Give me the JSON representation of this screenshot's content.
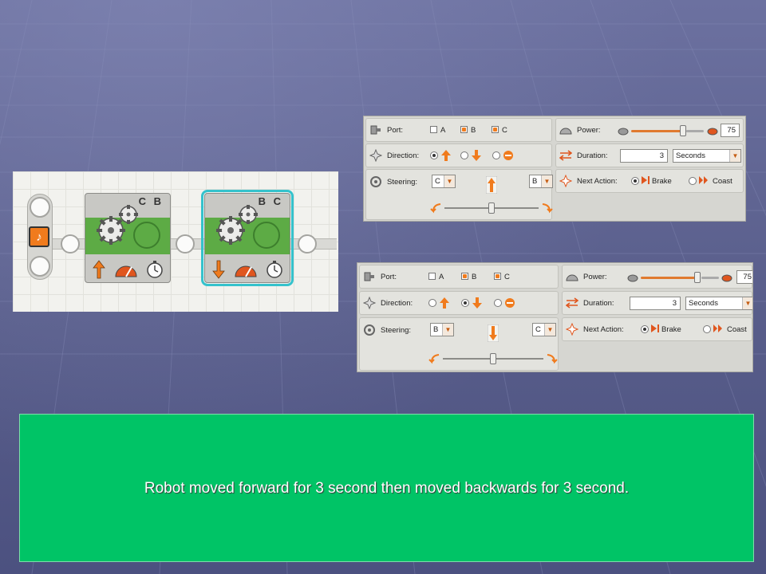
{
  "program": {
    "blocks": [
      {
        "ports": "C B",
        "direction": "forward"
      },
      {
        "ports": "B C",
        "direction": "backward",
        "selected": true
      }
    ]
  },
  "panel_a": {
    "port_label": "Port:",
    "port_options": [
      {
        "label": "A",
        "checked": false
      },
      {
        "label": "B",
        "checked": true
      },
      {
        "label": "C",
        "checked": true
      }
    ],
    "direction_label": "Direction:",
    "direction_selected": "forward",
    "steering_label": "Steering:",
    "steering_left": "C",
    "steering_right": "B",
    "steering_level": 0.5,
    "power_label": "Power:",
    "power_value": "75",
    "power_level": 0.75,
    "duration_label": "Duration:",
    "duration_value": "3",
    "duration_unit": "Seconds",
    "next_action_label": "Next Action:",
    "next_action_brake": "Brake",
    "next_action_coast": "Coast",
    "next_action_selected": "brake"
  },
  "panel_b": {
    "port_label": "Port:",
    "port_options": [
      {
        "label": "A",
        "checked": false
      },
      {
        "label": "B",
        "checked": true
      },
      {
        "label": "C",
        "checked": true
      }
    ],
    "direction_label": "Direction:",
    "direction_selected": "backward",
    "steering_label": "Steering:",
    "steering_left": "B",
    "steering_right": "C",
    "steering_level": 0.5,
    "power_label": "Power:",
    "power_value": "75",
    "power_level": 0.75,
    "duration_label": "Duration:",
    "duration_value": "3",
    "duration_unit": "Seconds",
    "next_action_label": "Next Action:",
    "next_action_brake": "Brake",
    "next_action_coast": "Coast",
    "next_action_selected": "brake"
  },
  "caption": {
    "text": "Robot moved forward for 3 second then moved backwards for 3 second."
  },
  "colors": {
    "background": "#5f6491",
    "caption_bg": "#00c466",
    "accent_orange": "#f07b1d",
    "block_green": "#5dab45",
    "selection_cyan": "#35c2cc"
  }
}
